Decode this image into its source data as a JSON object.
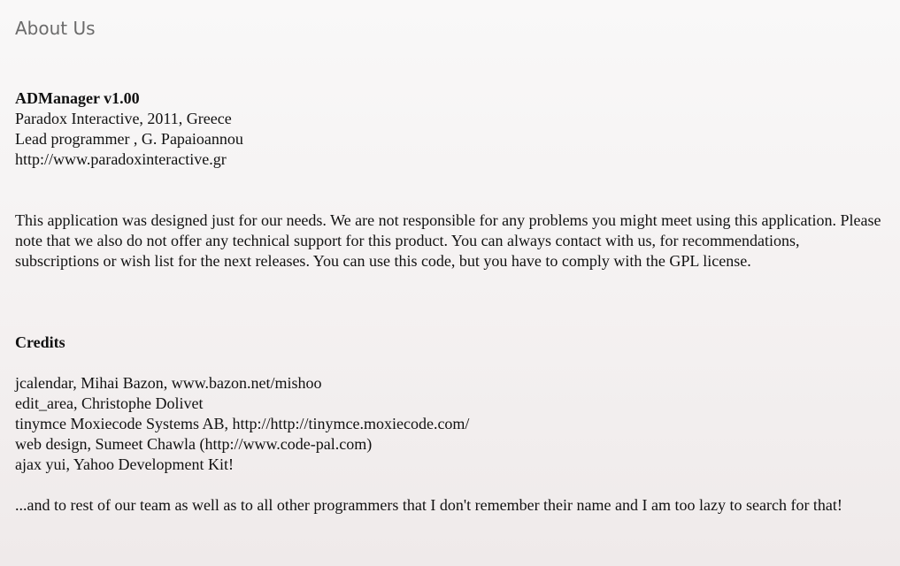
{
  "page": {
    "title": "About Us"
  },
  "product": {
    "name": "ADManager v1.00",
    "company": "Paradox Interactive, 2011, Greece",
    "lead": "Lead programmer , G. Papaioannou",
    "website": "http://www.paradoxinteractive.gr"
  },
  "disclaimer": "This application was designed just for our needs. We are not responsible for any problems you might meet using this application. Please note that we also do not offer any technical support for this product. You can always contact with us, for recommendations, subscriptions or wish list for the next releases. You can use this code, but you have to comply with the GPL license.",
  "credits": {
    "heading": "Credits",
    "items": [
      "jcalendar, Mihai Bazon, www.bazon.net/mishoo",
      "edit_area, Christophe Dolivet",
      "tinymce Moxiecode Systems AB, http://http://tinymce.moxiecode.com/",
      "web design, Sumeet Chawla (http://www.code-pal.com)",
      "ajax yui, Yahoo Development Kit!"
    ],
    "thanks": "...and to rest of our team as well as to all other programmers that I don't remember their name and I am too lazy to search for that!"
  }
}
